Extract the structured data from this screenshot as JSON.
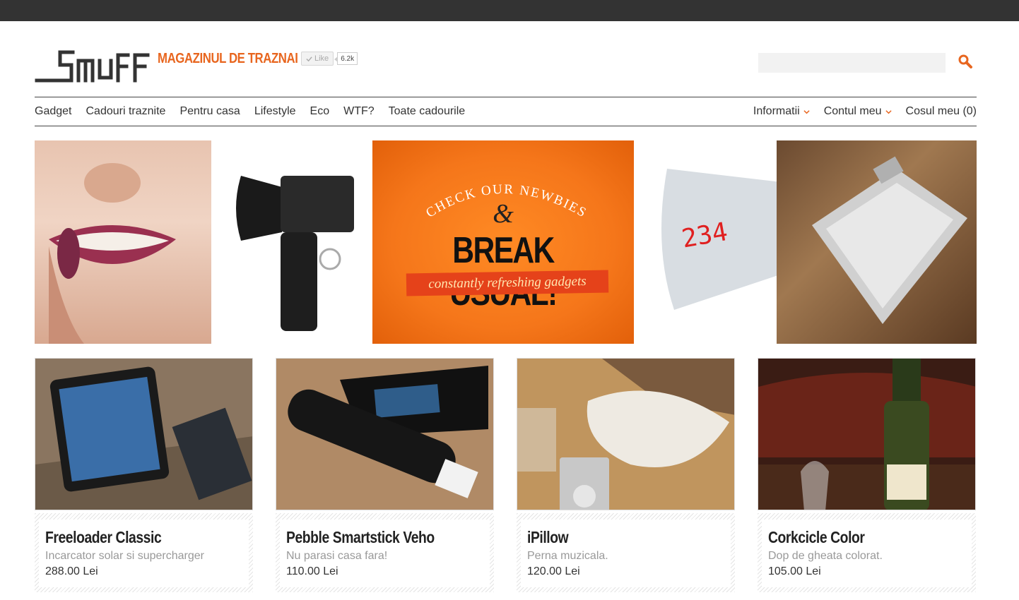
{
  "header": {
    "tagline": "MAGAZINUL DE TRAZNAI",
    "like_label": "Like",
    "like_count": "6.2k",
    "search_placeholder": ""
  },
  "nav": {
    "left": [
      "Gadget",
      "Cadouri traznite",
      "Pentru casa",
      "Lifestyle",
      "Eco",
      "WTF?",
      "Toate cadourile"
    ],
    "informatii": "Informatii",
    "contul": "Contul meu",
    "cosul": "Cosul meu (0)"
  },
  "banner": {
    "arc_text": "CHECK OUR NEWBIES",
    "amp": "&",
    "main": "BREAK USUAL!",
    "ribbon": "constantly refreshing gadgets",
    "scale_display": "234"
  },
  "products": [
    {
      "name": "Freeloader Classic",
      "desc": "Incarcator solar si supercharger",
      "price": "288.00 Lei"
    },
    {
      "name": "Pebble Smartstick Veho",
      "desc": "Nu parasi casa fara!",
      "price": "110.00 Lei"
    },
    {
      "name": "iPillow",
      "desc": "Perna muzicala.",
      "price": "120.00 Lei"
    },
    {
      "name": "Corkcicle Color",
      "desc": "Dop de gheata colorat.",
      "price": "105.00 Lei"
    }
  ],
  "colors": {
    "accent": "#e8661f",
    "topbar": "#333333",
    "text": "#222222"
  },
  "icons": {
    "search": "search-icon",
    "dropdown": "chevron-down-icon",
    "like": "check-icon"
  }
}
